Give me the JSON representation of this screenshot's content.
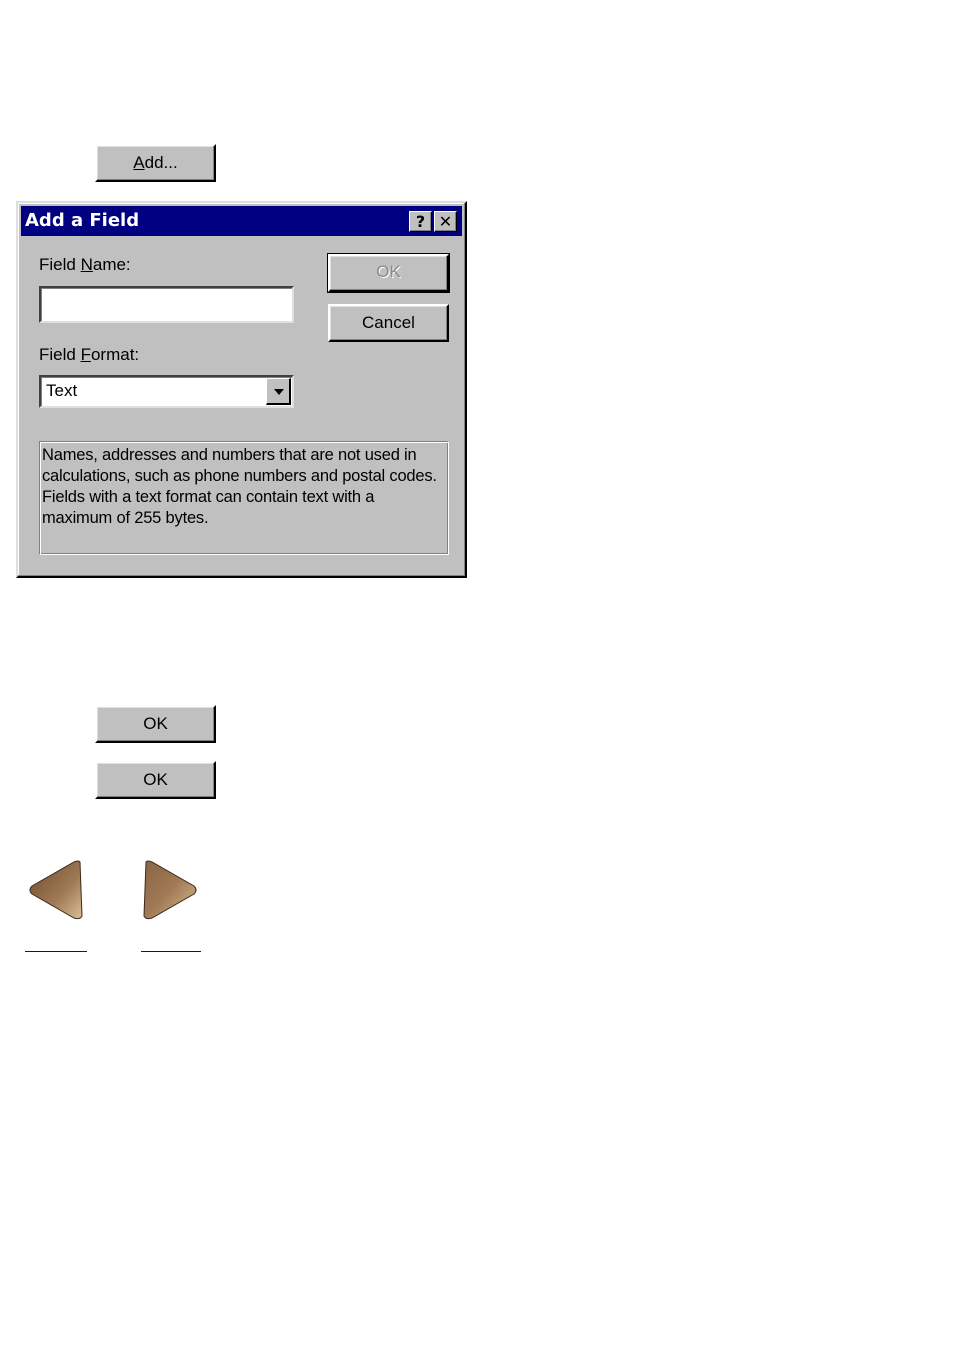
{
  "top_button": {
    "label_access_key": "A",
    "label_rest": "dd..."
  },
  "dialog": {
    "title": "Add a Field",
    "help_button": "?",
    "close_button": "✕",
    "field_name": {
      "label_prefix": "Field ",
      "label_access_key": "N",
      "label_rest": "ame:",
      "value": ""
    },
    "field_format": {
      "label_prefix": "Field ",
      "label_access_key": "F",
      "label_rest": "ormat:",
      "selected": "Text"
    },
    "ok_label": "OK",
    "ok_disabled": true,
    "cancel_label": "Cancel",
    "description_lines": [
      "Names, addresses and numbers that are not used in calculations, such as phone numbers and postal codes.",
      "Fields with a text format can contain text with a maximum of 255 bytes."
    ]
  },
  "bottom_buttons": [
    {
      "label": "OK"
    },
    {
      "label": "OK"
    }
  ],
  "navigation": {
    "prev_icon": "left-arrow-icon",
    "next_icon": "right-arrow-icon",
    "prev_link_text": "",
    "next_link_text": ""
  },
  "colors": {
    "titlebar": "#000080",
    "dialog_face": "#c0c0c0",
    "arrow_brown": "#8b6a4a",
    "link": "#0000ee"
  }
}
